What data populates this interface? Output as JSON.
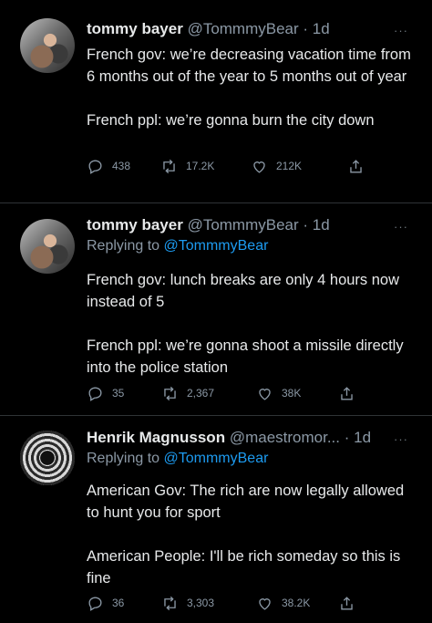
{
  "tweets": [
    {
      "name": "tommy bayer",
      "handle": "@TommmyBear",
      "time": "· 1d",
      "more": "···",
      "lines": [
        "French gov: we’re decreasing vacation time from 6 months out of the year to 5 months out of year",
        "French ppl: we’re gonna burn the city down"
      ],
      "replies": "438",
      "retweets": "17.2K",
      "likes": "212K"
    },
    {
      "name": "tommy bayer",
      "handle": "@TommmyBear",
      "time": "· 1d",
      "more": "···",
      "replying_prefix": "Replying to ",
      "replying_to": "@TommmyBear",
      "lines": [
        "French gov: lunch breaks are only 4 hours now instead of 5",
        "French ppl: we’re gonna shoot a missile directly into the police  station"
      ],
      "replies": "35",
      "retweets": "2,367",
      "likes": "38K"
    },
    {
      "name": "Henrik Magnusson",
      "handle": "@maestromor...",
      "time": "· 1d",
      "more": "···",
      "replying_prefix": "Replying to ",
      "replying_to": "@TommmyBear",
      "lines": [
        "American Gov: The rich are now legally allowed to hunt you for sport",
        "American People: I'll be rich someday so this is fine"
      ],
      "replies": "36",
      "retweets": "3,303",
      "likes": "38.2K"
    }
  ],
  "icons": {
    "reply": "reply-icon",
    "retweet": "retweet-icon",
    "like": "heart-icon",
    "share": "share-icon"
  },
  "colors": {
    "background": "#000000",
    "text": "#e7e9ea",
    "muted": "#8b98a5",
    "link": "#1d9bf0",
    "divider": "#2f3336"
  }
}
